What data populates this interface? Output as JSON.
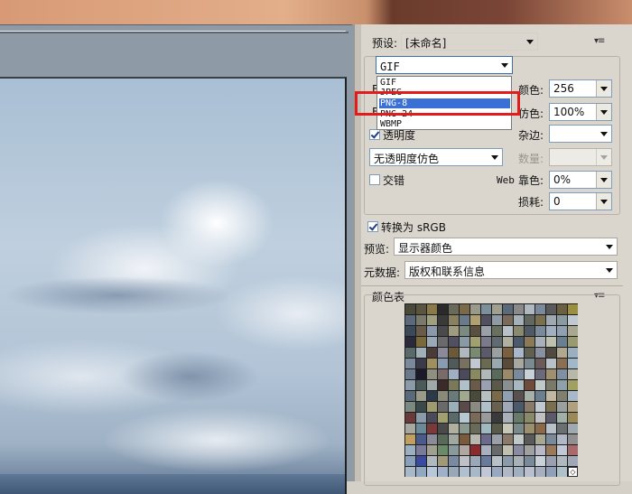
{
  "panel": {
    "preset_label": "预设:",
    "preset_value": "[未命名]",
    "format_value": "GIF",
    "format_options": [
      "GIF",
      "JPEG",
      "PNG-8",
      "PNG-24",
      "WBMP"
    ],
    "format_selected": "PNG-8",
    "colors_label": "颜色:",
    "colors_value": "256",
    "dither_label": "仿色:",
    "dither_value": "100%",
    "transparency_label": "透明度",
    "transparency_checked": true,
    "matte_label": "杂边:",
    "matte_value": "",
    "transparency_dither_value": "无透明度仿色",
    "amount_label": "数量:",
    "amount_value": "",
    "interlaced_label": "交错",
    "interlaced_checked": false,
    "web_snap_label_web": "Web",
    "web_snap_label": "靠色:",
    "web_snap_value": "0%",
    "lossy_label": "损耗:",
    "lossy_value": "0",
    "convert_srgb_label": "转换为 sRGB",
    "convert_srgb_checked": true,
    "preview_label": "预览:",
    "preview_value": "显示器颜色",
    "metadata_label": "元数据:",
    "metadata_value": "版权和联系信息",
    "color_table_label": "颜色表"
  },
  "colors": {
    "highlight_box": "#e21b1b",
    "selected_option_bg": "#3a6fd6"
  },
  "color_table_swatches": [
    "#4a4a3a",
    "#5a5540",
    "#8a7a4a",
    "#2a2a2a",
    "#6a6a5a",
    "#7a6a4a",
    "#9a9a8a",
    "#7e8f9c",
    "#a0a090",
    "#5a6a7a",
    "#8a8a8a",
    "#b0b8c0",
    "#7a8a9a",
    "#5a5a5a",
    "#6a6040",
    "#9a9040",
    "#5a6a7a",
    "#7a7a6a",
    "#a0a080",
    "#3a3a3a",
    "#8a8060",
    "#6a7a8a",
    "#b0a070",
    "#505060",
    "#909aa5",
    "#7a6a5a",
    "#a5b0b8",
    "#606860",
    "#7a7050",
    "#a0a8b0",
    "#8a9aa0",
    "#c0c8d0",
    "#3a4a5a",
    "#6a5a4a",
    "#8a9aaa",
    "#4a4a4a",
    "#a09a80",
    "#7a8a80",
    "#5a5040",
    "#9aa0a8",
    "#6a7060",
    "#b8c0c8",
    "#8a8a70",
    "#505a64",
    "#7a8a9a",
    "#a0b0c0",
    "#90a0b0",
    "#a8a890",
    "#2a2a3a",
    "#7a6a3a",
    "#9aa8b8",
    "#6a6a6a",
    "#505060",
    "#8a9aa5",
    "#a0a070",
    "#7a7a8a",
    "#606a70",
    "#b0b0a0",
    "#4a5a6a",
    "#8a7a5a",
    "#a8b0b8",
    "#c0c0b0",
    "#6a8090",
    "#9a9a70",
    "#5a6a6a",
    "#a0b0b8",
    "#4a3a3a",
    "#8a8a9a",
    "#6a5a3a",
    "#b0b8c0",
    "#7a8a70",
    "#5a5a6a",
    "#9aa0a0",
    "#7a6040",
    "#a8b8c8",
    "#606050",
    "#8a90a0",
    "#504a40",
    "#b0a890",
    "#9ab0c0",
    "#7a8a9a",
    "#3a3a4a",
    "#a09060",
    "#8a9ab0",
    "#505a5a",
    "#7a7060",
    "#c0c8d0",
    "#6a6a50",
    "#9aa8b0",
    "#5a4a3a",
    "#a8a8a0",
    "#7a8a90",
    "#6a5a5a",
    "#b8c0c8",
    "#8a7050",
    "#a0b8c8",
    "#6a7a8a",
    "#1a1a2a",
    "#909080",
    "#7a6a6a",
    "#a0b0c0",
    "#4a4a5a",
    "#8a8a60",
    "#b0b8b8",
    "#5a6a5a",
    "#9a8a6a",
    "#7a8a9a",
    "#c8d0d8",
    "#6a6a7a",
    "#a09070",
    "#8090a0",
    "#b8b8a8",
    "#8a9aa8",
    "#4a5a5a",
    "#a0a8a8",
    "#3a2a2a",
    "#7a7a5a",
    "#b0c0c8",
    "#6a5a4a",
    "#9aa0b0",
    "#5a5a4a",
    "#8a9090",
    "#a8b8c0",
    "#704a3a",
    "#c0c8c8",
    "#7a7a6a",
    "#90a0a8",
    "#a0a060",
    "#5a6a7a",
    "#9a9a8a",
    "#2a3a4a",
    "#8a8a7a",
    "#6a7a7a",
    "#a0a890",
    "#4a4a3a",
    "#b8c0c0",
    "#7a6a4a",
    "#90a0b0",
    "#5a5050",
    "#a8b0a8",
    "#6a8090",
    "#c0b8a0",
    "#808070",
    "#a8b8c8",
    "#7a8a80",
    "#3a4a4a",
    "#a09a70",
    "#6a6a6a",
    "#9ab0b8",
    "#5a4a4a",
    "#8a8a80",
    "#b0c0c8",
    "#6a6050",
    "#a0a8b8",
    "#4a5a6a",
    "#8a7a6a",
    "#c0c8d0",
    "#7a7050",
    "#9aa0a0",
    "#b0a080",
    "#6a3a3a",
    "#8a9aa8",
    "#4a4a5a",
    "#a0a070",
    "#5a6a6a",
    "#b8c8d0",
    "#7a6a5a",
    "#9a9a9a",
    "#3a3a3a",
    "#a8b0b8",
    "#6a7a6a",
    "#8a8a6a",
    "#c0c0c0",
    "#5a5a6a",
    "#a0b0a8",
    "#9a8a5a",
    "#a8a8a0",
    "#6a8a9a",
    "#7a3a3a",
    "#4a4a4a",
    "#b0b0a0",
    "#8a9a90",
    "#6a6a5a",
    "#a0b8c0",
    "#5a5a4a",
    "#c8c8b8",
    "#7a8a8a",
    "#9a9070",
    "#8a6a4a",
    "#b8c0c8",
    "#6a7070",
    "#a0a8b0",
    "#c0a060",
    "#4a5a8a",
    "#8a8a9a",
    "#5a6a5a",
    "#a0a8a0",
    "#7a5a3a",
    "#b8b8b0",
    "#6a6a8a",
    "#9aa0a8",
    "#8a7a6a",
    "#c0c8c8",
    "#5a5a5a",
    "#a8a890",
    "#7a8a9a",
    "#b0b8c8",
    "#909090",
    "#9ab0c0",
    "#7a7a9a",
    "#a0a090",
    "#6a8a6a",
    "#8a9a9a",
    "#b0a8a0",
    "#8a2a2a",
    "#a8b0c0",
    "#6a6a6a",
    "#c0c0b0",
    "#8a8aa0",
    "#a0a0a0",
    "#b8b8c8",
    "#9a7a5a",
    "#c0c8d8",
    "#a86a6a",
    "#8aa0b8",
    "#3a4aa0",
    "#b0b8c0",
    "#a09a7a",
    "#7a8aa0",
    "#c0c0c8",
    "#9aa8b8",
    "#6a7a9a",
    "#b8c0c8",
    "#8a9aa8",
    "#a8b0b8",
    "#7a8a98",
    "#c8d0d8",
    "#9aa0b0",
    "#b0b8c0",
    "#a0a8b8",
    "#a8b8c8",
    "#90a8c0",
    "#b8c8d8",
    "#a0b0c8",
    "#98a8b8",
    "#b0c0d0",
    "#a8b8c8",
    "#c0c8d8",
    "#98a8c0",
    "#b0b8c8",
    "#a0b0c0",
    "#b8c0d0",
    "#a8b0c0",
    "#90a0b8",
    "#b0c0c8",
    "#ffffff"
  ]
}
